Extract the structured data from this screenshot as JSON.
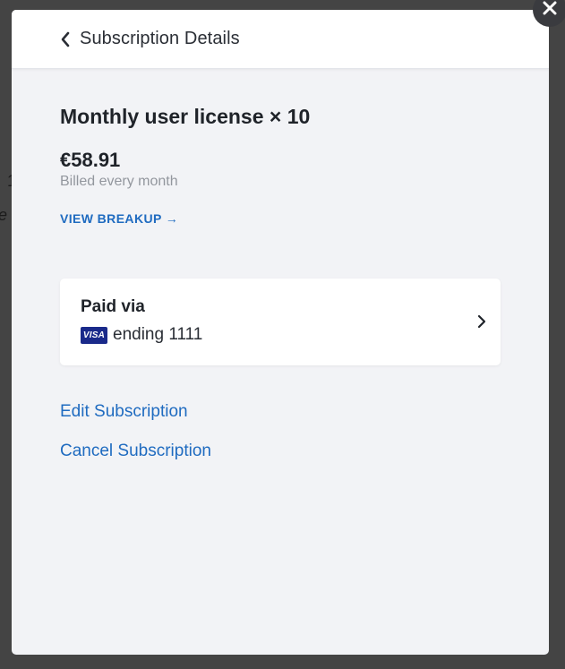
{
  "backdrop": {
    "fragment_a": "1",
    "fragment_b": "e"
  },
  "header": {
    "title": "Subscription Details",
    "back_icon": "chevron-left-icon"
  },
  "subscription": {
    "plan_title": "Monthly user license × 10",
    "price": "€58.91",
    "billing_cycle": "Billed every month",
    "breakup_link": "VIEW BREAKUP →"
  },
  "payment": {
    "label": "Paid via",
    "card_brand": "VISA",
    "card_ending": "ending 1111",
    "chevron_icon": "chevron-right-icon"
  },
  "actions": {
    "edit_label": "Edit Subscription",
    "cancel_label": "Cancel Subscription"
  },
  "close": {
    "icon": "close-icon"
  },
  "colors": {
    "link": "#1f6bc0",
    "modal_bg": "#f2f3f6",
    "overlay": "#444444",
    "visa_blue": "#1a2a8a"
  }
}
